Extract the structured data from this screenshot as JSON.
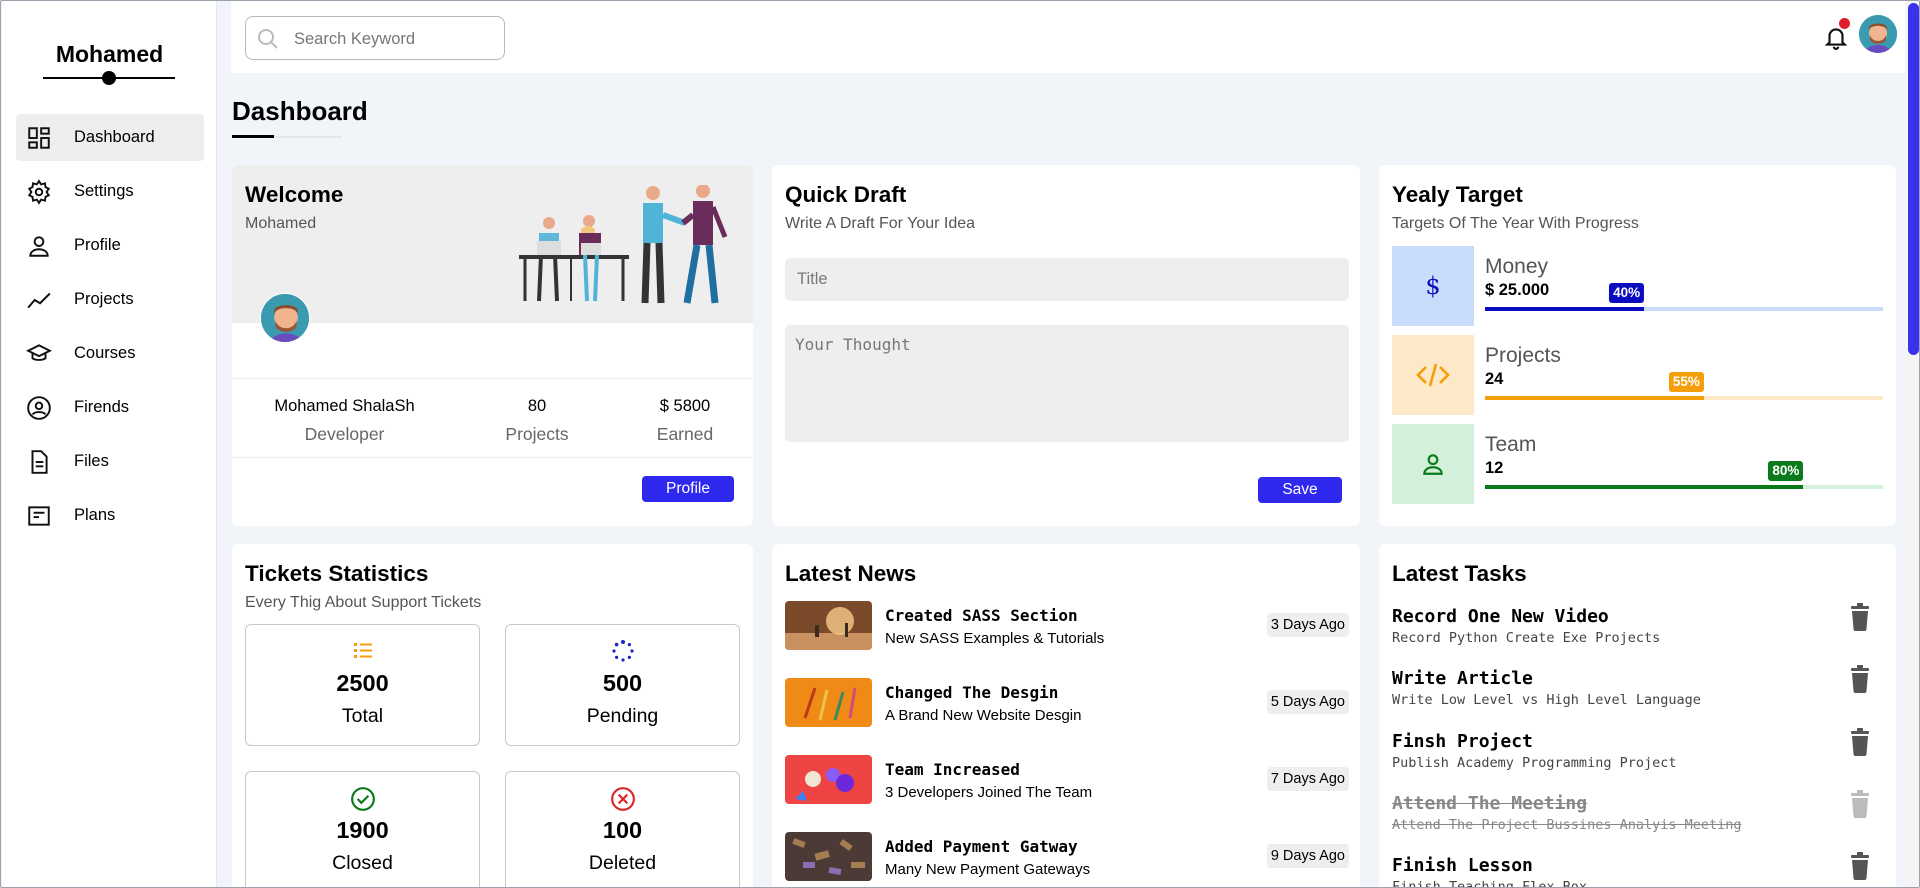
{
  "brand": "Mohamed",
  "sidebar": {
    "items": [
      {
        "label": "Dashboard",
        "icon": "dashboard-icon",
        "active": true
      },
      {
        "label": "Settings",
        "icon": "gear-icon"
      },
      {
        "label": "Profile",
        "icon": "user-icon"
      },
      {
        "label": "Projects",
        "icon": "chart-line-icon"
      },
      {
        "label": "Courses",
        "icon": "graduation-cap-icon"
      },
      {
        "label": "Firends",
        "icon": "user-circle-icon"
      },
      {
        "label": "Files",
        "icon": "file-icon"
      },
      {
        "label": "Plans",
        "icon": "list-card-icon"
      }
    ]
  },
  "header": {
    "search_placeholder": "Search Keyword",
    "notification_dot_color": "#e11d2e"
  },
  "page_title": "Dashboard",
  "welcome": {
    "title": "Welcome",
    "subtitle": "Mohamed",
    "stats": [
      {
        "value": "Mohamed ShalaSh",
        "label": "Developer"
      },
      {
        "value": "80",
        "label": "Projects"
      },
      {
        "value": "$ 5800",
        "label": "Earned"
      }
    ],
    "button": "Profile"
  },
  "draft": {
    "title": "Quick Draft",
    "subtitle": "Write A Draft For Your Idea",
    "title_placeholder": "Title",
    "text_placeholder": "Your Thought",
    "button": "Save"
  },
  "target": {
    "title": "Yealy Target",
    "subtitle": "Targets Of The Year With Progress",
    "rows": [
      {
        "name": "Money",
        "value": "$ 25.000",
        "progress": 40,
        "badge": "40%",
        "icon": "dollar-icon",
        "color": "#0b0bbf",
        "bg": "#c9dcfb",
        "track": "#c9dcfb"
      },
      {
        "name": "Projects",
        "value": "24",
        "progress": 55,
        "badge": "55%",
        "icon": "code-icon",
        "color": "#f59e0b",
        "bg": "#fde8c8",
        "track": "#fde8c8"
      },
      {
        "name": "Team",
        "value": "12",
        "progress": 80,
        "badge": "80%",
        "icon": "user-icon",
        "color": "#0b7a1b",
        "bg": "#d2f0da",
        "track": "#d2f0da"
      }
    ]
  },
  "tickets": {
    "title": "Tickets Statistics",
    "subtitle": "Every Thig About Support Tickets",
    "boxes": [
      {
        "number": "2500",
        "label": "Total",
        "icon": "list-icon",
        "color": "#f59e0b"
      },
      {
        "number": "500",
        "label": "Pending",
        "icon": "spinner-icon",
        "color": "#1d24c8"
      },
      {
        "number": "1900",
        "label": "Closed",
        "icon": "check-circle-icon",
        "color": "#0b7a1b"
      },
      {
        "number": "100",
        "label": "Deleted",
        "icon": "x-circle-icon",
        "color": "#dc2626"
      }
    ]
  },
  "news": {
    "title": "Latest News",
    "items": [
      {
        "heading": "Created SASS Section",
        "text": "New SASS Examples & Tutorials",
        "date": "3 Days Ago"
      },
      {
        "heading": "Changed The Desgin",
        "text": "A Brand New Website Desgin",
        "date": "5 Days Ago"
      },
      {
        "heading": "Team Increased",
        "text": "3 Developers Joined The Team",
        "date": "7 Days Ago"
      },
      {
        "heading": "Added Payment Gatway",
        "text": "Many New Payment Gateways",
        "date": "9 Days Ago"
      }
    ]
  },
  "tasks": {
    "title": "Latest Tasks",
    "items": [
      {
        "heading": "Record One New Video",
        "text": "Record Python Create Exe Projects",
        "done": false
      },
      {
        "heading": "Write Article",
        "text": "Write Low Level vs High Level Language",
        "done": false
      },
      {
        "heading": "Finsh Project",
        "text": "Publish Academy Programming Project",
        "done": false
      },
      {
        "heading": "Attend The Meeting",
        "text": "Attend The Project Bussines Analyis Meeting",
        "done": true
      },
      {
        "heading": "Finish Lesson",
        "text": "Finish Teaching Flex Box",
        "done": false
      }
    ]
  }
}
